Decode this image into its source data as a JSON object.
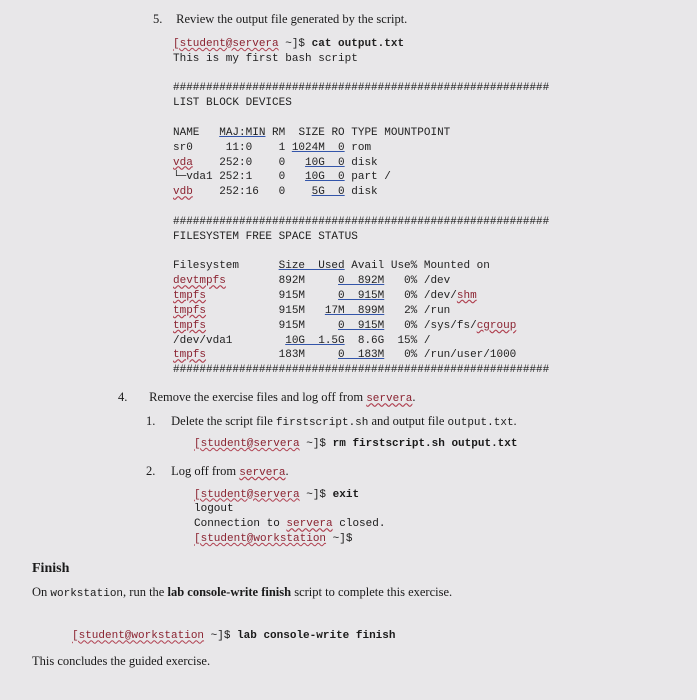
{
  "step5": {
    "num": "5.",
    "text": "Review the output file generated by the script.",
    "code": {
      "line1_prompt": "[student@servera",
      "line1_cmd": " ~]$ ",
      "line1_bold": "cat output.txt",
      "line2": "This is my first bash script",
      "hash1": "#########################################################",
      "list_title": "LIST BLOCK DEVICES",
      "lsblk_header": "NAME   MAJ:MIN RM  SIZE RO TYPE MOUNTPOINT",
      "lsblk_row1": "sr0     11:0    1 1024M  0 rom",
      "lsblk_row2_name": "vda",
      "lsblk_row2_rest": "    252:0    0   10G  0 disk",
      "lsblk_row3": "└─vda1 252:1    0   10G  0 part /",
      "lsblk_row4_name": "vdb",
      "lsblk_row4_rest": "    252:16   0    5G  0 disk",
      "hash2": "#########################################################",
      "fs_title": "FILESYSTEM FREE SPACE STATUS",
      "df_header": "Filesystem      Size  Used Avail Use% Mounted on",
      "df_r1_fs": "devtmpfs",
      "df_r1_rest": "        892M     0  892M   0% /dev",
      "df_r2_fs": "tmpfs",
      "df_r2_rest": "           915M     0  915M   0% /dev/shm",
      "df_r3_fs": "tmpfs",
      "df_r3_rest": "           915M   17M  899M   2% /run",
      "df_r4_fs": "tmpfs",
      "df_r4_rest": "           915M     0  915M   0% /sys/fs/cgroup",
      "df_r5": "/dev/vda1        10G  1.5G  8.6G  15% /",
      "df_r6_fs": "tmpfs",
      "df_r6_rest": "           183M     0  183M   0% /run/user/1000",
      "hash3": "#########################################################"
    }
  },
  "step4": {
    "num": "4.",
    "text_pre": "Remove the exercise files and log off from ",
    "text_host": "servera",
    "text_post": ".",
    "sub1": {
      "num": "1.",
      "text_pre": "Delete the script file ",
      "code1": "firstscript.sh",
      "mid": " and output file ",
      "code2": "output.txt",
      "post": ".",
      "cmd_prompt": "[student@servera",
      "cmd_sep": " ~]$ ",
      "cmd_bold": "rm firstscript.sh output.txt"
    },
    "sub2": {
      "num": "2.",
      "text_pre": "Log off from ",
      "text_host": "servera",
      "post": ".",
      "l1_prompt": "[student@servera",
      "l1_sep": " ~]$ ",
      "l1_bold": "exit",
      "l2": "logout",
      "l3_pre": "Connection to ",
      "l3_host": "servera",
      "l3_post": " closed.",
      "l4_prompt": "[student@workstation",
      "l4_sep": " ~]$"
    }
  },
  "finish": {
    "heading": "Finish",
    "line_pre": "On ",
    "line_host": "workstation",
    "line_mid": ", run the ",
    "line_bold": "lab console-write finish",
    "line_post": " script to complete this exercise.",
    "cmd_prompt": "[student@workstation",
    "cmd_sep": " ~]$ ",
    "cmd_bold": "lab console-write finish",
    "closing": "This concludes the guided exercise."
  }
}
